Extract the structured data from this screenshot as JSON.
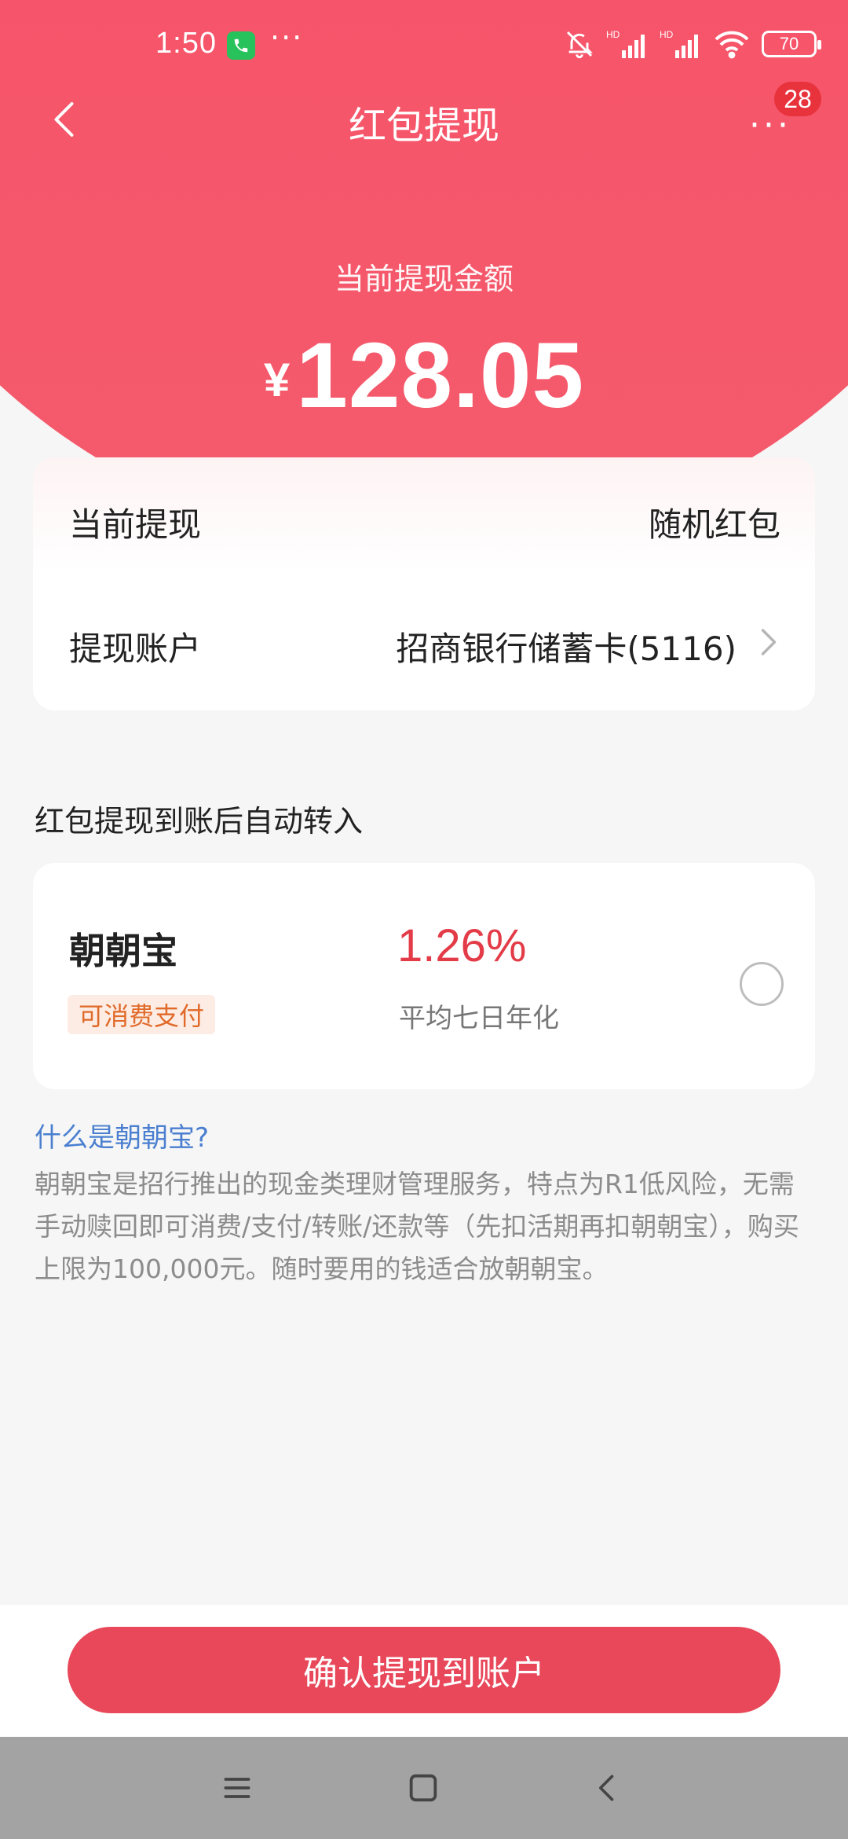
{
  "status_bar": {
    "time": "1:50",
    "more": "···",
    "battery": "70",
    "hd1": "HD",
    "hd2": "HD"
  },
  "header": {
    "title": "红包提现",
    "more_icon": "···",
    "badge_count": "28"
  },
  "amount": {
    "label": "当前提现金额",
    "currency": "¥",
    "value": "128.05"
  },
  "details": {
    "current_label": "当前提现",
    "current_value": "随机红包",
    "account_label": "提现账户",
    "account_value": "招商银行储蓄卡(5116)"
  },
  "auto_transfer": {
    "title": "红包提现到账后自动转入",
    "product_name": "朝朝宝",
    "product_tag": "可消费支付",
    "rate": "1.26%",
    "rate_label": "平均七日年化"
  },
  "info": {
    "link": "什么是朝朝宝?",
    "text": "朝朝宝是招行推出的现金类理财管理服务，特点为R1低风险，无需手动赎回即可消费/支付/转账/还款等（先扣活期再扣朝朝宝），购买上限为100,000元。随时要用的钱适合放朝朝宝。"
  },
  "actions": {
    "confirm": "确认提现到账户"
  },
  "icons": {
    "back": "back-arrow-icon",
    "more": "more-dots-icon",
    "chevron": "chevron-right-icon",
    "radio": "radio-unchecked-icon",
    "call": "phone-call-icon",
    "mute": "bell-off-icon",
    "signal": "signal-icon",
    "wifi": "wifi-icon",
    "battery": "battery-icon",
    "nav_menu": "menu-icon",
    "nav_home": "home-square-icon",
    "nav_back": "nav-back-icon"
  },
  "colors": {
    "brand_red": "#f24a5b",
    "button_red": "#e8485a",
    "rate_red": "#e33b47",
    "link_blue": "#4a7fd0",
    "tag_orange": "#e06a2a"
  }
}
